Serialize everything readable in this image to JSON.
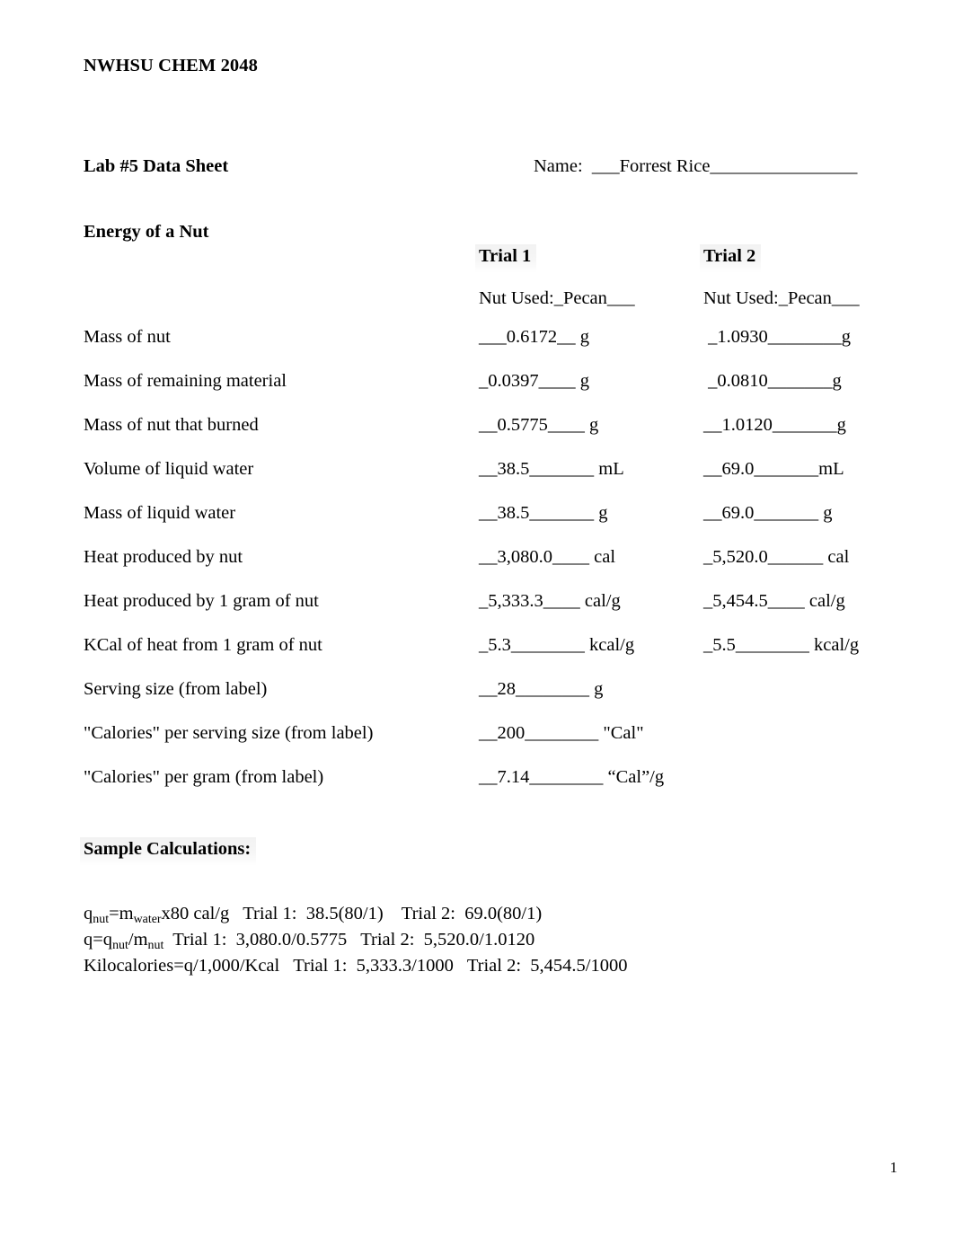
{
  "header": {
    "course": "NWHSU CHEM 2048",
    "doc_title": "Lab #5 Data Sheet",
    "name_line": "Name:  ___Forrest Rice________________"
  },
  "section": {
    "title": "Energy of a Nut"
  },
  "columns": [
    {
      "head": "Trial 1",
      "nut_used": "Nut Used:_Pecan___"
    },
    {
      "head": "Trial 2",
      "nut_used": "Nut Used:_Pecan___"
    }
  ],
  "rows": [
    {
      "label": "Mass of nut",
      "trial1": "___0.6172__ g",
      "trial2": " _1.0930________g"
    },
    {
      "label": "Mass of remaining material",
      "trial1": "_0.0397____ g",
      "trial2": " _0.0810_______g"
    },
    {
      "label": "Mass of nut that burned",
      "trial1": "__0.5775____ g",
      "trial2": "__1.0120_______g"
    },
    {
      "label": "Volume of liquid water",
      "trial1": "__38.5_______ mL",
      "trial2": "__69.0_______mL"
    },
    {
      "label": "Mass of liquid water",
      "trial1": "__38.5_______ g",
      "trial2": "__69.0_______ g"
    },
    {
      "label": "Heat produced by nut",
      "trial1": "__3,080.0____ cal",
      "trial2": "_5,520.0______ cal"
    },
    {
      "label": "Heat produced by 1 gram of nut",
      "trial1": "_5,333.3____ cal/g",
      "trial2": "_5,454.5____ cal/g"
    },
    {
      "label": "KCal of heat from 1 gram of nut",
      "trial1": "_5.3________ kcal/g",
      "trial2": "_5.5________ kcal/g"
    },
    {
      "label": "Serving size (from label)",
      "trial1": "__28________ g",
      "trial2": ""
    },
    {
      "label": "\"Calories\" per serving size (from label)",
      "trial1": "__200________ \"Cal\"",
      "trial2": ""
    },
    {
      "label": "\"Calories\" per gram (from label)",
      "trial1": "__7.14________ “Cal”/g",
      "trial2": ""
    }
  ],
  "calculations": {
    "title": "Sample Calculations:",
    "line1_pre": "q",
    "line1_sub1": "nut",
    "line1_mid": "=m",
    "line1_sub2": "water",
    "line1_post": "x80 cal/g   Trial 1:  38.5(80/1)    Trial 2:  69.0(80/1)",
    "line2_pre": "q=q",
    "line2_sub1": "nut",
    "line2_mid": "/m",
    "line2_sub2": "nut",
    "line2_post": "  Trial 1:  3,080.0/0.5775   Trial 2:  5,520.0/1.0120",
    "line3": "Kilocalories=q/1,000/Kcal   Trial 1:  5,333.3/1000   Trial 2:  5,454.5/1000"
  },
  "footer": {
    "page_number": "1"
  }
}
